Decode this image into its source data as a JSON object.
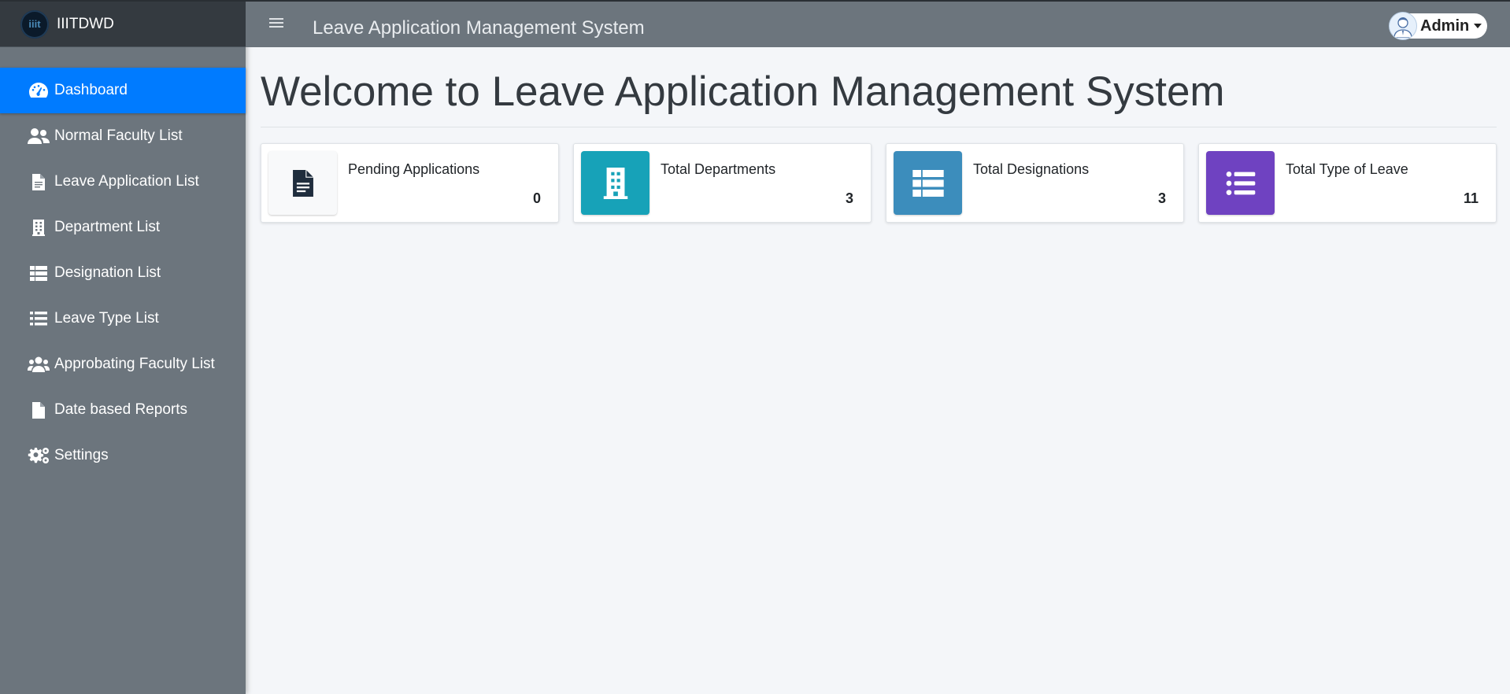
{
  "brand": {
    "name": "IIITDWD",
    "logo_text": "iiit"
  },
  "topbar": {
    "title": "Leave Application Management System",
    "user": "Admin"
  },
  "sidebar": {
    "items": [
      {
        "label": "Dashboard",
        "icon": "tachometer-icon",
        "active": true
      },
      {
        "label": "Normal Faculty List",
        "icon": "users-icon"
      },
      {
        "label": "Leave Application List",
        "icon": "file-text-icon"
      },
      {
        "label": "Department List",
        "icon": "building-icon"
      },
      {
        "label": "Designation List",
        "icon": "table-icon"
      },
      {
        "label": "Leave Type List",
        "icon": "list-icon"
      },
      {
        "label": "Approbating Faculty List",
        "icon": "users-group-icon"
      },
      {
        "label": "Date based Reports",
        "icon": "file-icon"
      },
      {
        "label": "Settings",
        "icon": "cogs-icon"
      }
    ]
  },
  "main": {
    "heading": "Welcome to Leave Application Management System",
    "cards": [
      {
        "label": "Pending Applications",
        "value": "0",
        "icon": "file-text-icon",
        "color": "#f8f9fa"
      },
      {
        "label": "Total Departments",
        "value": "3",
        "icon": "building-icon",
        "color": "#17a2b8"
      },
      {
        "label": "Total Designations",
        "value": "3",
        "icon": "table-icon",
        "color": "#3c8dbc"
      },
      {
        "label": "Total Type of Leave",
        "value": "11",
        "icon": "list-icon",
        "color": "#6f42c1"
      }
    ]
  },
  "colors": {
    "sidebar": "#6c757d",
    "active": "#007bff",
    "brand_bar": "#343a40",
    "page_bg": "#f4f6f9"
  }
}
